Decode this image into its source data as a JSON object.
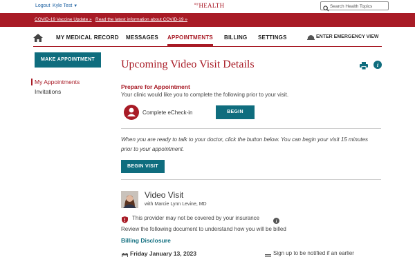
{
  "topbar": {
    "logout": "Logout",
    "user": "Kyle Test",
    "brand_prefix": "my",
    "brand": "HEALTH",
    "search_placeholder": "Search Health Topics"
  },
  "alerts": {
    "vaccine": "COVID-19 Vaccine Update »",
    "latest": "Read the latest information about COVID-19 »"
  },
  "nav": {
    "items": [
      "MY MEDICAL RECORD",
      "MESSAGES",
      "APPOINTMENTS",
      "BILLING",
      "SETTINGS"
    ],
    "active": "APPOINTMENTS",
    "emergency": "ENTER EMERGENCY VIEW"
  },
  "sidebar": {
    "make_appointment": "MAKE APPOINTMENT",
    "items": [
      "My Appointments",
      "Invitations"
    ]
  },
  "page": {
    "title": "Upcoming Video Visit Details",
    "prepare_heading": "Prepare for Appointment",
    "prepare_text": "Your clinic would like you to complete the following prior to your visit.",
    "echeckin_label": "Complete eCheck-in",
    "begin_label": "BEGIN",
    "visit_note": "When you are ready to talk to your doctor, click the button below. You can begin your visit 15 minutes prior to your appointment.",
    "begin_visit_label": "BEGIN VISIT"
  },
  "visit": {
    "type": "Video Visit",
    "with": "with Marcie Lynn Levine, MD",
    "insurance_warning": "This provider may not be covered by your insurance",
    "review_text": "Review the following document to understand how you will be billed",
    "billing_link": "Billing Disclosure",
    "date": "Friday January 13, 2023",
    "notify_text": "Sign up to be notified if an earlier"
  },
  "colors": {
    "brand_red": "#a81b26",
    "teal": "#0f6d7e",
    "link_blue": "#1a5fa0"
  }
}
